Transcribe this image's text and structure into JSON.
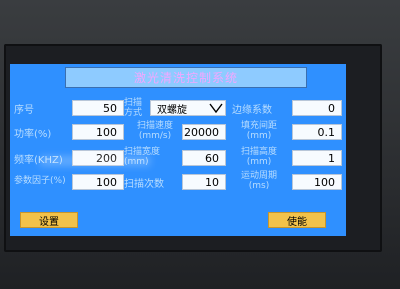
{
  "screen": {
    "title": "激光清洗控制系统",
    "fields": {
      "seq": {
        "label": "序号",
        "value": "50"
      },
      "scan_mode": {
        "label_line1": "扫描",
        "label_line2": "方式",
        "value": "双螺旋"
      },
      "edge_coeff": {
        "label": "边缘系数",
        "value": "0"
      },
      "power": {
        "label": "功率(%)",
        "value": "100"
      },
      "scan_speed": {
        "label_line1": "扫描速度",
        "label_line2": "(mm/s)",
        "value": "20000"
      },
      "fill_spacing": {
        "label_line1": "填充间距",
        "label_line2": "(mm)",
        "value": "0.1"
      },
      "frequency": {
        "label": "频率(KHZ)",
        "value": "200"
      },
      "scan_width": {
        "label_line1": "扫描宽度",
        "label_line2": "(mm)",
        "value": "60"
      },
      "scan_height": {
        "label_line1": "扫描高度",
        "label_line2": "(mm)",
        "value": "1"
      },
      "param_factor": {
        "label": "参数因子(%)",
        "value": "100"
      },
      "scan_count": {
        "label": "扫描次数",
        "value": "10"
      },
      "motion_period": {
        "label_line1": "运动周期",
        "label_line2": "(ms)",
        "value": "100"
      }
    },
    "buttons": {
      "settings": "设置",
      "enable": "使能"
    }
  },
  "colors": {
    "screen_bg": "#2f90ff",
    "title_bg": "#8ecbff",
    "button_bg": "#f2c24a",
    "label_text": "#b8ddff"
  }
}
